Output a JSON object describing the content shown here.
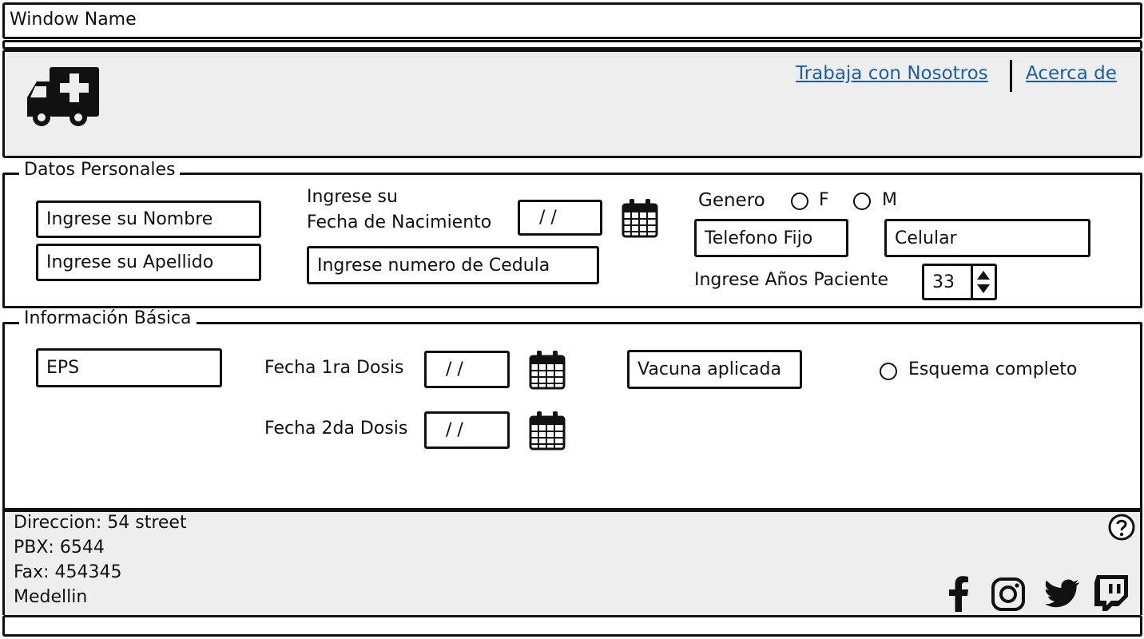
{
  "window": {
    "title": "Window Name"
  },
  "header": {
    "logo_icon": "ambulance-icon",
    "links": {
      "work_with_us": "Trabaja con Nosotros",
      "about": "Acerca de"
    },
    "link_color": "#1c5fa8"
  },
  "personal": {
    "legend": "Datos Personales",
    "name_placeholder": "Ingrese su Nombre",
    "lastname_placeholder": "Ingrese su Apellido",
    "birthdate_label_line1": "Ingrese su",
    "birthdate_label_line2": "Fecha de Nacimiento",
    "birthdate_value": "/ /",
    "cedula_placeholder": "Ingrese numero de Cedula",
    "gender_label": "Genero",
    "gender_options": {
      "f": "F",
      "m": "M"
    },
    "phone_placeholder": "Telefono Fijo",
    "mobile_placeholder": "Celular",
    "age_label": "Ingrese Años Paciente",
    "age_value": "33"
  },
  "basic": {
    "legend": "Información Básica",
    "eps_placeholder": "EPS",
    "dose1_label": "Fecha 1ra Dosis",
    "dose1_value": "/ /",
    "dose2_label": "Fecha 2da Dosis",
    "dose2_value": "/ /",
    "vaccine_placeholder": "Vacuna aplicada",
    "scheme_label": "Esquema completo"
  },
  "footer": {
    "address": "Direccion: 54  street",
    "pbx": "PBX: 6544",
    "fax": "Fax: 454345",
    "city": "Medellin",
    "help_icon": "help-icon",
    "social_icons": [
      "facebook-icon",
      "instagram-icon",
      "twitter-icon",
      "twitch-icon"
    ]
  }
}
